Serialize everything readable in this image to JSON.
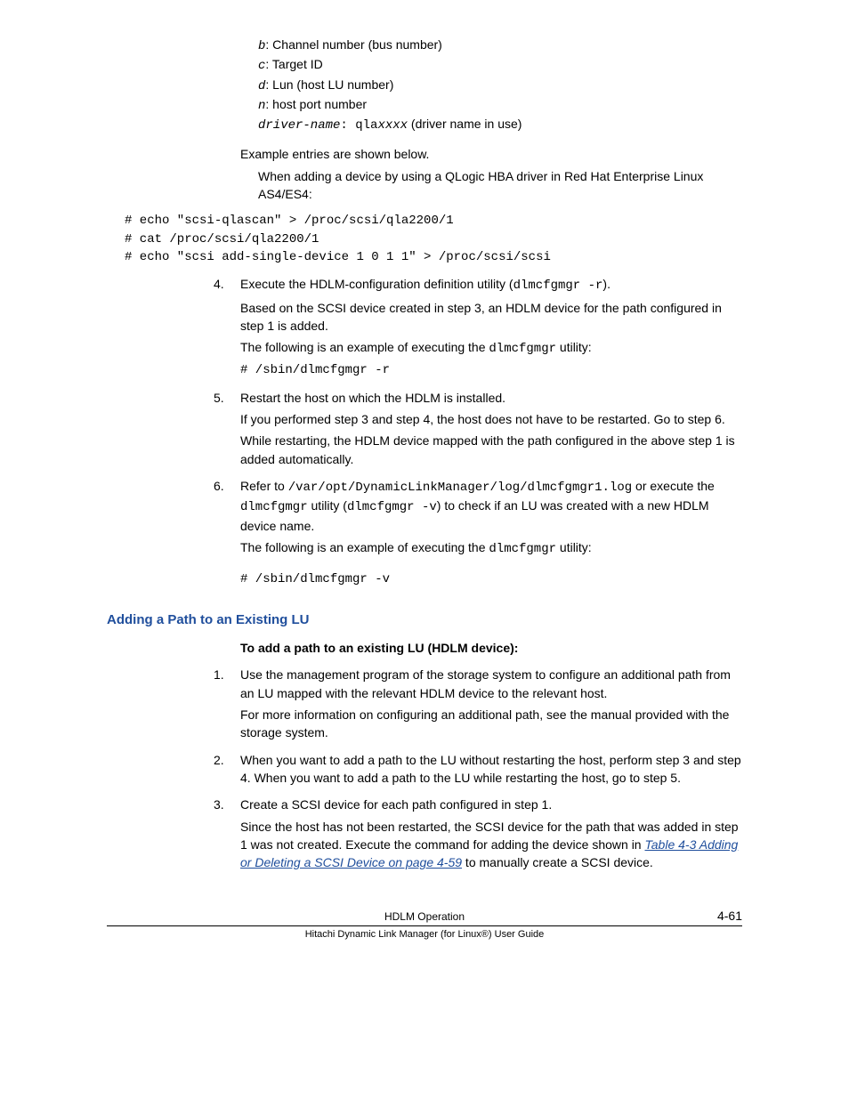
{
  "vars": {
    "b_var": "b",
    "b_desc": ": Channel number (bus number)",
    "c_var": "c",
    "c_desc": ": Target ID",
    "d_var": "d",
    "d_desc": ": Lun (host LU number)",
    "n_var": "n",
    "n_desc": ": host port number",
    "drv_var": "driver-name",
    "drv_mid": ": qla",
    "drv_xxxx": "xxxx",
    "drv_end": " (driver name in use)"
  },
  "example_intro": "Example entries are shown below.",
  "example_desc": "When adding a device by using a QLogic HBA driver in Red Hat Enterprise Linux AS4/ES4:",
  "example_code": "# echo \"scsi-qlascan\" > /proc/scsi/qla2200/1\n# cat /proc/scsi/qla2200/1\n# echo \"scsi add-single-device 1 0 1 1\" > /proc/scsi/scsi",
  "step4": {
    "num": "4.",
    "line1a": "Execute the HDLM-configuration definition utility (",
    "line1b": "dlmcfgmgr -r",
    "line1c": ").",
    "line2": "Based on the SCSI device created in step 3, an HDLM device for the path configured in step 1 is added.",
    "line3a": "The following is an example of executing the ",
    "line3b": "dlmcfgmgr",
    "line3c": " utility:",
    "code": "# /sbin/dlmcfgmgr -r"
  },
  "step5": {
    "num": "5.",
    "line1": "Restart the host on which the HDLM is installed.",
    "line2": "If you performed step 3 and step 4, the host does not have to be restarted. Go to step 6.",
    "line3": "While restarting, the HDLM device mapped with the path configured in the above step 1 is added automatically."
  },
  "step6": {
    "num": "6.",
    "l1a": "Refer to ",
    "l1b": "/var/opt/DynamicLinkManager/log/dlmcfgmgr1.log",
    "l1c": " or execute the ",
    "l1d": "dlmcfgmgr",
    "l1e": " utility (",
    "l1f": "dlmcfgmgr -v",
    "l1g": ") to check if an LU was created with a new HDLM device name.",
    "l2a": "The following is an example of executing the ",
    "l2b": "dlmcfgmgr",
    "l2c": " utility:",
    "code": "# /sbin/dlmcfgmgr -v"
  },
  "section_title": "Adding a Path to an Existing LU",
  "sub_bold": "To add a path to an existing LU (HDLM device):",
  "s1": {
    "num": "1.",
    "l1": "Use the management program of the storage system to configure an additional path from an LU mapped with the relevant HDLM device to the relevant host.",
    "l2": "For more information on configuring an additional path, see the manual provided with the storage system."
  },
  "s2": {
    "num": "2.",
    "l1": "When you want to add a path to the LU without restarting the host, perform step 3 and step 4. When you want to add a path to the LU while restarting the host, go to step 5."
  },
  "s3": {
    "num": "3.",
    "l1": "Create a SCSI device for each path configured in step 1.",
    "l2a": "Since the host has not been restarted, the SCSI device for the path that was added in step 1 was not created. Execute the command for adding the device shown in ",
    "l2link": "Table 4-3 Adding or Deleting a SCSI Device on page 4-59",
    "l2b": " to manually create a SCSI device."
  },
  "footer": {
    "title": "HDLM Operation",
    "sub": "Hitachi Dynamic Link Manager (for Linux®) User Guide",
    "page": "4-61"
  }
}
